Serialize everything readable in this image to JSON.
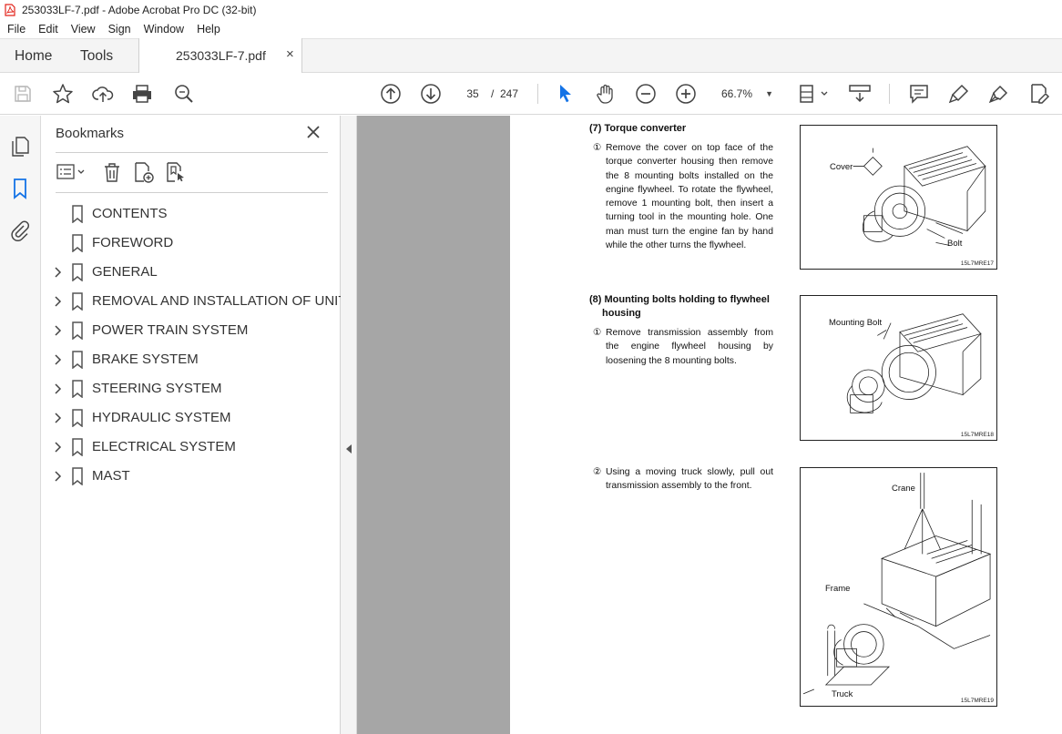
{
  "window": {
    "title": "253033LF-7.pdf - Adobe Acrobat Pro DC (32-bit)"
  },
  "menu": [
    "File",
    "Edit",
    "View",
    "Sign",
    "Window",
    "Help"
  ],
  "tabs": {
    "home": "Home",
    "tools": "Tools",
    "document": "253033LF-7.pdf",
    "close": "×"
  },
  "toolbar": {
    "page_current": "35",
    "page_sep": "/",
    "page_total": "247",
    "zoom": "66.7%"
  },
  "bookmarks": {
    "title": "Bookmarks",
    "items": [
      {
        "label": "CONTENTS",
        "expandable": false
      },
      {
        "label": "FOREWORD",
        "expandable": false
      },
      {
        "label": "GENERAL",
        "expandable": true
      },
      {
        "label": "REMOVAL AND INSTALLATION OF UNIT",
        "expandable": true
      },
      {
        "label": "POWER TRAIN SYSTEM",
        "expandable": true
      },
      {
        "label": "BRAKE SYSTEM",
        "expandable": true
      },
      {
        "label": "STEERING SYSTEM",
        "expandable": true
      },
      {
        "label": "HYDRAULIC SYSTEM",
        "expandable": true
      },
      {
        "label": "ELECTRICAL SYSTEM",
        "expandable": true
      },
      {
        "label": "MAST",
        "expandable": true
      }
    ]
  },
  "document": {
    "section7": {
      "heading": "(7) Torque converter",
      "step1_marker": "①",
      "step1": "Remove the cover on top face of the torque converter housing then remove the 8 mounting bolts installed on the engine flywheel.  To rotate the flywheel, remove 1 mounting bolt, then insert a turning tool in the mounting hole.  One man must turn the engine fan by hand while the other turns the flywheel.",
      "figure": {
        "label_cover": "Cover",
        "label_bolt": "Bolt",
        "code": "15L7MRE17"
      }
    },
    "section8": {
      "heading_line1": "(8) Mounting bolts holding to flywheel",
      "heading_line2": "housing",
      "step1_marker": "①",
      "step1": "Remove transmission assembly from the engine flywheel housing by loosening the 8 mounting bolts.",
      "figure": {
        "label_bolt": "Mounting Bolt",
        "code": "15L7MRE18"
      },
      "step2_marker": "②",
      "step2": "Using a moving truck slowly, pull out transmission assembly to the front.",
      "figure2": {
        "label_crane": "Crane",
        "label_frame": "Frame",
        "label_truck": "Truck",
        "code": "15L7MRE19"
      }
    }
  },
  "colors": {
    "accent_blue": "#1473e6",
    "canvas_gray": "#a6a6a6",
    "pdf_red": "#e2231a"
  }
}
